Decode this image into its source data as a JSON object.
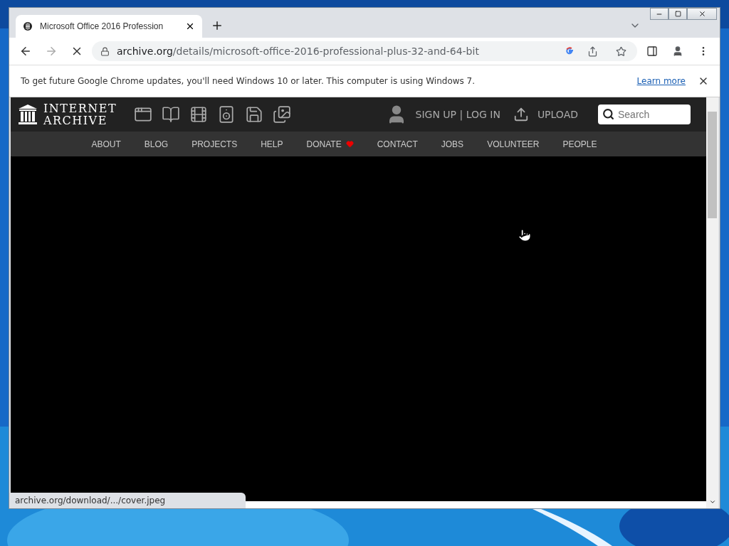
{
  "tabs": [
    {
      "title": "Microsoft Office 2016 Profession",
      "selected": true
    }
  ],
  "toolbar": {
    "loading": true,
    "address": {
      "host": "archive.org",
      "path": "/details/microsoft-office-2016-professional-plus-32-and-64-bit"
    }
  },
  "infobar": {
    "message": "To get future Google Chrome updates, you'll need Windows 10 or later. This computer is using Windows 7.",
    "link": "Learn more"
  },
  "site": {
    "logo": {
      "line1": "INTERNET",
      "line2": "ARCHIVE"
    },
    "media": [
      {
        "kind": "web"
      },
      {
        "kind": "texts"
      },
      {
        "kind": "video"
      },
      {
        "kind": "audio"
      },
      {
        "kind": "software"
      },
      {
        "kind": "images"
      }
    ],
    "account": "SIGN UP | LOG IN",
    "upload": "UPLOAD",
    "search": {
      "placeholder": "Search"
    },
    "nav": [
      {
        "label": "ABOUT",
        "kind": "link"
      },
      {
        "label": "BLOG",
        "kind": "link"
      },
      {
        "label": "PROJECTS",
        "kind": "link"
      },
      {
        "label": "HELP",
        "kind": "link"
      },
      {
        "label": "DONATE",
        "kind": "donate"
      },
      {
        "label": "CONTACT",
        "kind": "link"
      },
      {
        "label": "JOBS",
        "kind": "link"
      },
      {
        "label": "VOLUNTEER",
        "kind": "link"
      },
      {
        "label": "PEOPLE",
        "kind": "link"
      }
    ]
  },
  "status_bar": "archive.org/download/.../cover.jpeg"
}
